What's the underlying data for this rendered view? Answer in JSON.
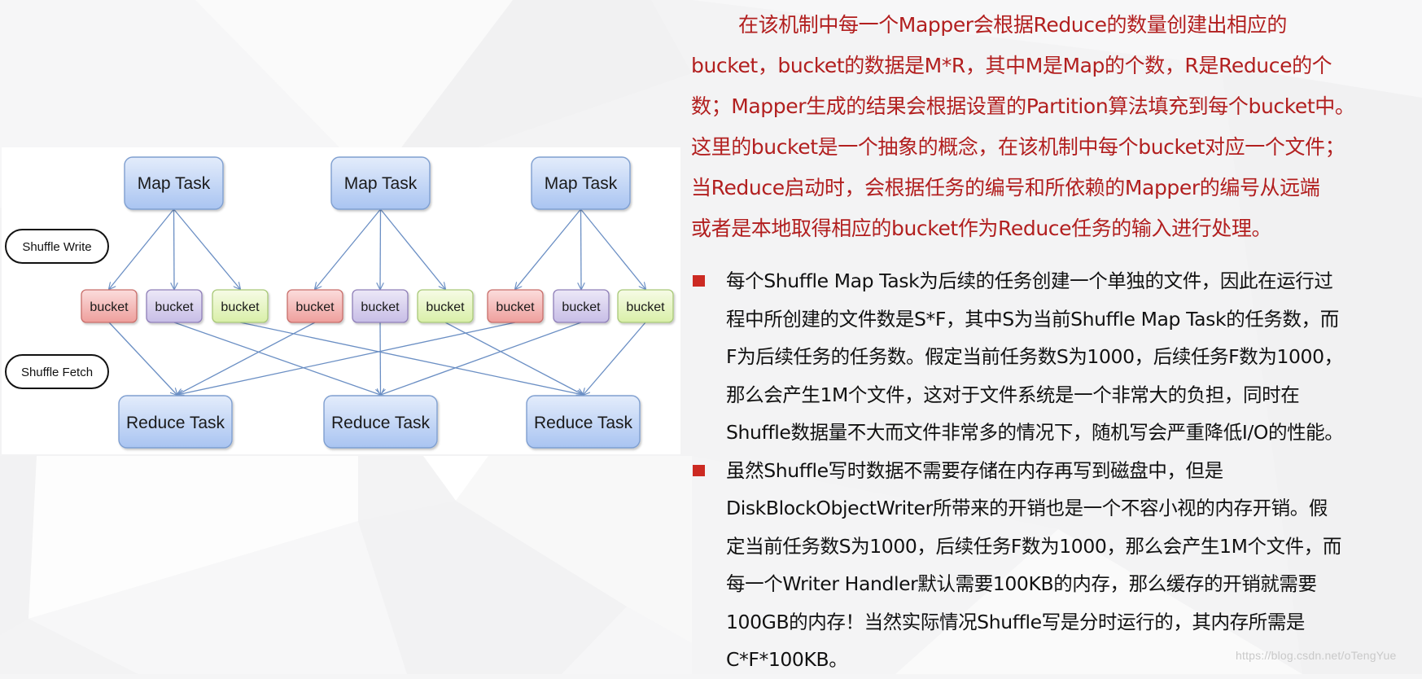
{
  "diagram": {
    "lanes": [
      {
        "label": "Shuffle Write"
      },
      {
        "label": "Shuffle Fetch"
      }
    ],
    "map_tasks": [
      {
        "label": "Map Task"
      },
      {
        "label": "Map Task"
      },
      {
        "label": "Map Task"
      }
    ],
    "reduce_tasks": [
      {
        "label": "Reduce Task"
      },
      {
        "label": "Reduce Task"
      },
      {
        "label": "Reduce Task"
      }
    ],
    "buckets": [
      {
        "label": "bucket",
        "map": 0,
        "reduce": 0,
        "color": "red"
      },
      {
        "label": "bucket",
        "map": 0,
        "reduce": 1,
        "color": "purple"
      },
      {
        "label": "bucket",
        "map": 0,
        "reduce": 2,
        "color": "green"
      },
      {
        "label": "bucket",
        "map": 1,
        "reduce": 0,
        "color": "red"
      },
      {
        "label": "bucket",
        "map": 1,
        "reduce": 1,
        "color": "purple"
      },
      {
        "label": "bucket",
        "map": 1,
        "reduce": 2,
        "color": "green"
      },
      {
        "label": "bucket",
        "map": 2,
        "reduce": 0,
        "color": "red"
      },
      {
        "label": "bucket",
        "map": 2,
        "reduce": 1,
        "color": "purple"
      },
      {
        "label": "bucket",
        "map": 2,
        "reduce": 2,
        "color": "green"
      }
    ],
    "colors": {
      "task_fill_top": "#e3ecfb",
      "task_fill_bottom": "#a9c4f1",
      "task_stroke": "#7f9fd0",
      "edge": "#6b8fc4",
      "red_top": "#fbdcdc",
      "red_bottom": "#ee9f9c",
      "red_stroke": "#c86e6b",
      "purple_top": "#ece8f7",
      "purple_bottom": "#c7bde6",
      "purple_stroke": "#8f7fb8",
      "green_top": "#f6fbe6",
      "green_bottom": "#d9efa8",
      "green_stroke": "#a8c878"
    }
  },
  "intro": {
    "lines": [
      "在该机制中每一个Mapper会根据Reduce的数量创建出相应的",
      "bucket，bucket的数据是M*R，其中M是Map的个数，R是Reduce的个",
      "数；Mapper生成的结果会根据设置的Partition算法填充到每个bucket中。",
      "这里的bucket是一个抽象的概念，在该机制中每个bucket对应一个文件；",
      "当Reduce启动时，会根据任务的编号和所依赖的Mapper的编号从远端",
      "或者是本地取得相应的bucket作为Reduce任务的输入进行处理。"
    ]
  },
  "bullets": [
    {
      "lines": [
        "每个Shuffle Map Task为后续的任务创建一个单独的文件，因此在运行过",
        "程中所创建的文件数是S*F，其中S为当前Shuffle Map Task的任务数，而",
        "F为后续任务的任务数。假定当前任务数S为1000，后续任务F数为1000，",
        "那么会产生1M个文件，这对于文件系统是一个非常大的负担，同时在",
        "Shuffle数据量不大而文件非常多的情况下，随机写会严重降低I/O的性能。"
      ]
    },
    {
      "lines": [
        "虽然Shuffle写时数据不需要存储在内存再写到磁盘中，但是",
        "DiskBlockObjectWriter所带来的开销也是一个不容小视的内存开销。假",
        "定当前任务数S为1000，后续任务F数为1000，那么会产生1M个文件，而",
        "每一个Writer Handler默认需要100KB的内存，那么缓存的开销就需要",
        "100GB的内存！当然实际情况Shuffle写是分时运行的，其内存所需是",
        "C*F*100KB。"
      ]
    }
  ],
  "watermark": "https://blog.csdn.net/oTengYue"
}
